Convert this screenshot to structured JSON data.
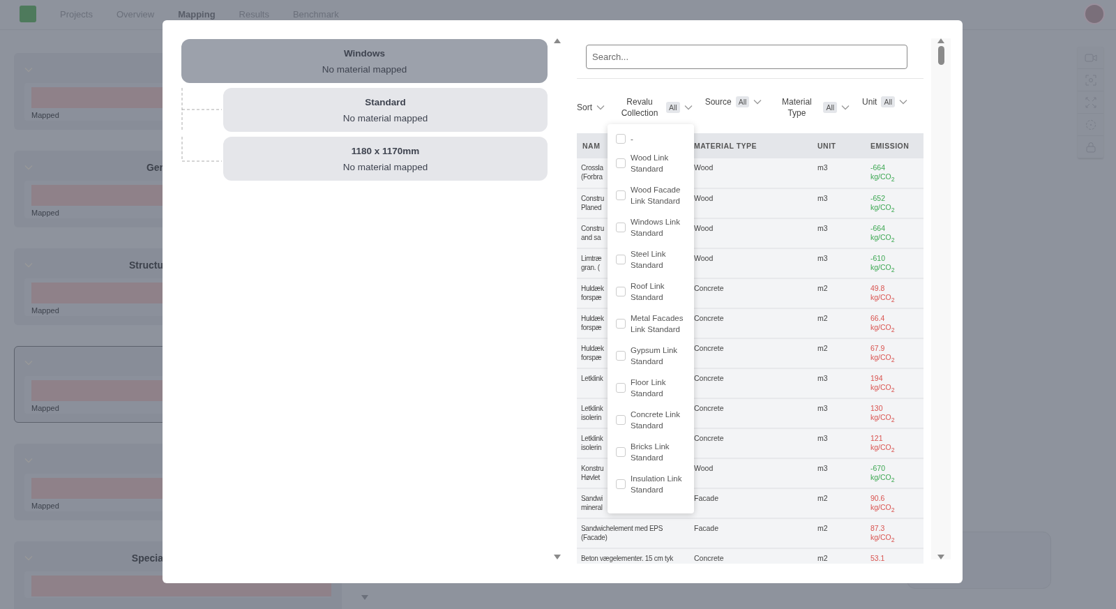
{
  "nav": {
    "tabs": [
      {
        "label": "Projects",
        "selected": false
      },
      {
        "label": "Overview",
        "selected": false
      },
      {
        "label": "Mapping",
        "selected": true
      },
      {
        "label": "Results",
        "selected": false
      },
      {
        "label": "Benchmark",
        "selected": false
      }
    ]
  },
  "background_cards": [
    {
      "status": "Mapped",
      "selected": false
    },
    {
      "title": "Ger",
      "status": "Mapped",
      "selected": false
    },
    {
      "title": "Structu",
      "status": "Mapped",
      "selected": false
    },
    {
      "status": "Mapped",
      "selected": true
    },
    {
      "status": "Mapped",
      "selected": false
    },
    {
      "title": "Specia",
      "selected": false
    }
  ],
  "modal": {
    "tree": {
      "label": "Windows",
      "status": "No material mapped",
      "selected": true,
      "children": [
        {
          "label": "Standard",
          "status": "No material mapped",
          "selected": false
        },
        {
          "label": "1180 x 1170mm",
          "status": "No material mapped",
          "selected": false
        }
      ]
    },
    "search": {
      "placeholder": "Search..."
    },
    "filters": [
      {
        "label": "Sort"
      },
      {
        "label": "Revalu Collection",
        "badge": "All"
      },
      {
        "label": "Source",
        "badge": "All"
      },
      {
        "label": "Material Type",
        "badge": "All"
      },
      {
        "label": "Unit",
        "badge": "All"
      }
    ],
    "table": {
      "columns": [
        "NAM",
        "MATERIAL TYPE",
        "UNIT",
        "EMISSION"
      ],
      "rows": [
        {
          "name_lines": [
            "Crossla",
            "(Forbra"
          ],
          "material_type": "Wood",
          "unit": "m3",
          "emission": "-664",
          "emission_unit": "kg/CO$_{2}$",
          "color": "#3da752"
        },
        {
          "name_lines": [
            "Constru",
            "Planed"
          ],
          "material_type": "Wood",
          "unit": "m3",
          "emission": "-652",
          "emission_unit": "kg/CO$_{2}$",
          "color": "#3da752"
        },
        {
          "name_lines": [
            "Constru",
            "and sa"
          ],
          "material_type": "Wood",
          "unit": "m3",
          "emission": "-664",
          "emission_unit": "kg/CO$_{2}$",
          "color": "#3da752"
        },
        {
          "name_lines": [
            "Limtræ",
            "gran. ("
          ],
          "material_type": "Wood",
          "unit": "m3",
          "emission": "-610",
          "emission_unit": "kg/CO$_{2}$",
          "color": "#3da752"
        },
        {
          "name_lines": [
            "Huldæk",
            "forspæ"
          ],
          "material_type": "Concrete",
          "unit": "m2",
          "emission": "49.8",
          "emission_unit": "kg/CO$_{2}$",
          "color": "#d9534f"
        },
        {
          "name_lines": [
            "Huldæk",
            "forspæ"
          ],
          "material_type": "Concrete",
          "unit": "m2",
          "emission": "66.4",
          "emission_unit": "kg/CO$_{2}$",
          "color": "#d9534f"
        },
        {
          "name_lines": [
            "Huldæk",
            "forspæ"
          ],
          "material_type": "Concrete",
          "unit": "m2",
          "emission": "67.9",
          "emission_unit": "kg/CO$_{2}$",
          "color": "#d9534f"
        },
        {
          "name_lines": [
            "Letklink"
          ],
          "material_type": "Concrete",
          "unit": "m3",
          "emission": "194",
          "emission_unit": "kg/CO$_{2}$",
          "color": "#d9534f"
        },
        {
          "name_lines": [
            "Letklink",
            "isolerin"
          ],
          "material_type": "Concrete",
          "unit": "m3",
          "emission": "130",
          "emission_unit": "kg/CO$_{2}$",
          "color": "#d9534f"
        },
        {
          "name_lines": [
            "Letklink",
            "isolerin"
          ],
          "material_type": "Concrete",
          "unit": "m3",
          "emission": "121",
          "emission_unit": "kg/CO$_{2}$",
          "color": "#d9534f"
        },
        {
          "name_lines": [
            "Konstru",
            "Høvlet"
          ],
          "material_type": "Wood",
          "unit": "m3",
          "emission": "-670",
          "emission_unit": "kg/CO$_{2}$",
          "color": "#3da752"
        },
        {
          "name_lines": [
            "Sandwi",
            "mineral"
          ],
          "material_type": "Facade",
          "unit": "m2",
          "emission": "90.6",
          "emission_unit": "kg/CO$_{2}$",
          "color": "#d9534f"
        },
        {
          "name_lines": [
            "Sandwichelement med EPS",
            "(Facade)"
          ],
          "material_type": "Facade",
          "unit": "m2",
          "emission": "87.3",
          "emission_unit": "kg/CO$_{2}$",
          "color": "#d9534f"
        },
        {
          "name_lines": [
            "Beton vægelementer. 15 cm tyk"
          ],
          "material_type": "Concrete",
          "unit": "m2",
          "emission": "53.1",
          "color": "#d9534f"
        }
      ]
    },
    "dropdown": {
      "options": [
        {
          "label": "-",
          "checked": false
        },
        {
          "label": "Wood Link Standard",
          "checked": false
        },
        {
          "label": "Wood Facade Link Standard",
          "checked": false
        },
        {
          "label": "Windows Link Standard",
          "checked": false
        },
        {
          "label": "Steel Link Standard",
          "checked": false
        },
        {
          "label": "Roof Link Standard",
          "checked": false
        },
        {
          "label": "Metal Facades Link Standard",
          "checked": false
        },
        {
          "label": "Gypsum Link Standard",
          "checked": false
        },
        {
          "label": "Floor Link Standard",
          "checked": false
        },
        {
          "label": "Concrete Link Standard",
          "checked": false
        },
        {
          "label": "Bricks Link Standard",
          "checked": false
        },
        {
          "label": "Insulation Link Standard",
          "checked": false
        }
      ]
    }
  }
}
